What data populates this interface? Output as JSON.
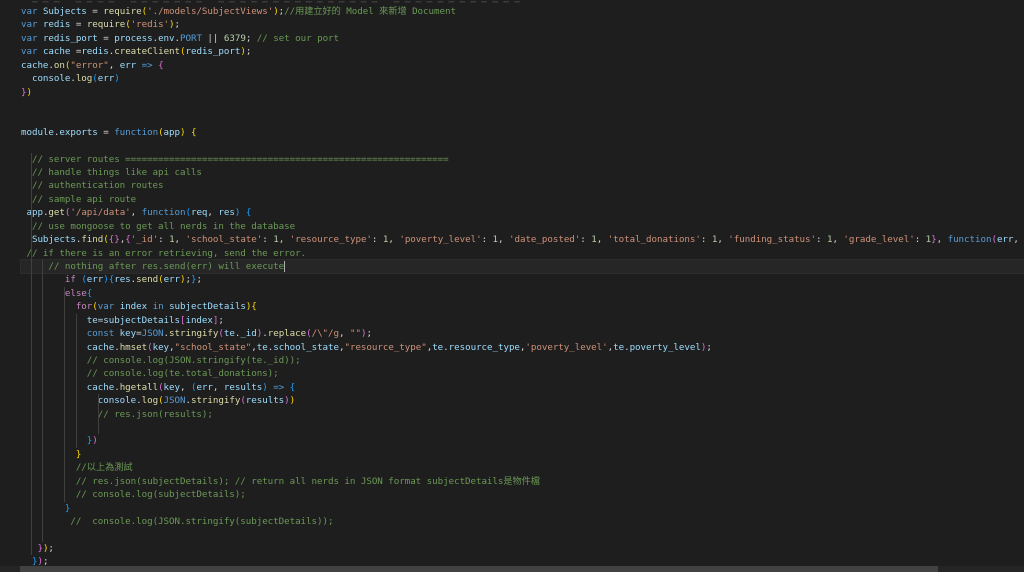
{
  "editor": {
    "top_partial": "  ─ ─ ─   ─ ─ ─ ─   ─ ─ ─ ─ ─ ─ ─   ─ ─ ─ ─ ─ ─ ─ ─ ─ ─ ─ ─ ─ ─ ─   ─ ─ ─ ─ ─ ─ ─ ─ ─ ─ ─ ─",
    "lines": [
      [
        [
          "kw",
          "var "
        ],
        [
          "var",
          "Subjects"
        ],
        [
          "pn",
          " = "
        ],
        [
          "fn",
          "require"
        ],
        [
          "br1",
          "("
        ],
        [
          "str",
          "'./models/SubjectViews'"
        ],
        [
          "br1",
          ")"
        ],
        [
          "pn",
          ";"
        ],
        [
          "cm",
          "//用建立好的 Model 來新增 Document"
        ]
      ],
      [
        [
          "kw",
          "var "
        ],
        [
          "var",
          "redis"
        ],
        [
          "pn",
          " = "
        ],
        [
          "fn",
          "require"
        ],
        [
          "br1",
          "("
        ],
        [
          "str",
          "'redis'"
        ],
        [
          "br1",
          ")"
        ],
        [
          "pn",
          ";"
        ]
      ],
      [
        [
          "kw",
          "var "
        ],
        [
          "var",
          "redis_port"
        ],
        [
          "pn",
          " = "
        ],
        [
          "var",
          "process"
        ],
        [
          "pn",
          "."
        ],
        [
          "var",
          "env"
        ],
        [
          "pn",
          "."
        ],
        [
          "kw",
          "PORT"
        ],
        [
          "pn",
          " || "
        ],
        [
          "num",
          "6379"
        ],
        [
          "pn",
          "; "
        ],
        [
          "cm",
          "// set our port"
        ]
      ],
      [
        [
          "kw",
          "var "
        ],
        [
          "var",
          "cache"
        ],
        [
          "pn",
          " ="
        ],
        [
          "var",
          "redis"
        ],
        [
          "pn",
          "."
        ],
        [
          "fn",
          "createClient"
        ],
        [
          "br1",
          "("
        ],
        [
          "var",
          "redis_port"
        ],
        [
          "br1",
          ")"
        ],
        [
          "pn",
          ";"
        ]
      ],
      [
        [
          "var",
          "cache"
        ],
        [
          "pn",
          "."
        ],
        [
          "fn",
          "on"
        ],
        [
          "br1",
          "("
        ],
        [
          "str",
          "\"error\""
        ],
        [
          "pn",
          ", "
        ],
        [
          "var",
          "err"
        ],
        [
          "pn",
          " "
        ],
        [
          "kw",
          "=>"
        ],
        [
          "pn",
          " "
        ],
        [
          "br2",
          "{"
        ]
      ],
      [
        [
          "pn",
          "  "
        ],
        [
          "var",
          "console"
        ],
        [
          "pn",
          "."
        ],
        [
          "fn",
          "log"
        ],
        [
          "br3",
          "("
        ],
        [
          "var",
          "err"
        ],
        [
          "br3",
          ")"
        ]
      ],
      [
        [
          "br2",
          "}"
        ],
        [
          "br1",
          ")"
        ]
      ],
      [],
      [],
      [
        [
          "var",
          "module"
        ],
        [
          "pn",
          "."
        ],
        [
          "var",
          "exports"
        ],
        [
          "pn",
          " = "
        ],
        [
          "kw",
          "function"
        ],
        [
          "br1",
          "("
        ],
        [
          "var",
          "app"
        ],
        [
          "br1",
          ")"
        ],
        [
          "pn",
          " "
        ],
        [
          "br1",
          "{"
        ]
      ],
      [],
      [
        [
          "pn",
          "  "
        ],
        [
          "cm",
          "// server routes ==========================================================="
        ]
      ],
      [
        [
          "pn",
          "  "
        ],
        [
          "cm",
          "// handle things like api calls"
        ]
      ],
      [
        [
          "pn",
          "  "
        ],
        [
          "cm",
          "// authentication routes"
        ]
      ],
      [
        [
          "pn",
          "  "
        ],
        [
          "cm",
          "// sample api route"
        ]
      ],
      [
        [
          "pn",
          " "
        ],
        [
          "var",
          "app"
        ],
        [
          "pn",
          "."
        ],
        [
          "fn",
          "get"
        ],
        [
          "br2",
          "("
        ],
        [
          "str",
          "'/api/data'"
        ],
        [
          "pn",
          ", "
        ],
        [
          "kw",
          "function"
        ],
        [
          "br3",
          "("
        ],
        [
          "var",
          "req"
        ],
        [
          "pn",
          ", "
        ],
        [
          "var",
          "res"
        ],
        [
          "br3",
          ")"
        ],
        [
          "pn",
          " "
        ],
        [
          "br3",
          "{"
        ]
      ],
      [
        [
          "pn",
          "  "
        ],
        [
          "cm",
          "// use mongoose to get all nerds in the database"
        ]
      ],
      [
        [
          "pn",
          "  "
        ],
        [
          "var",
          "Subjects"
        ],
        [
          "pn",
          "."
        ],
        [
          "fn",
          "find"
        ],
        [
          "br1",
          "("
        ],
        [
          "br2",
          "{}"
        ],
        [
          "pn",
          ","
        ],
        [
          "br2",
          "{"
        ],
        [
          "str",
          "'_id'"
        ],
        [
          "pn",
          ": "
        ],
        [
          "num",
          "1"
        ],
        [
          "pn",
          ", "
        ],
        [
          "str",
          "'school_state'"
        ],
        [
          "pn",
          ": "
        ],
        [
          "num",
          "1"
        ],
        [
          "pn",
          ", "
        ],
        [
          "str",
          "'resource_type'"
        ],
        [
          "pn",
          ": "
        ],
        [
          "num",
          "1"
        ],
        [
          "pn",
          ", "
        ],
        [
          "str",
          "'poverty_level'"
        ],
        [
          "pn",
          ": "
        ],
        [
          "num",
          "1"
        ],
        [
          "pn",
          ", "
        ],
        [
          "str",
          "'date_posted'"
        ],
        [
          "pn",
          ": "
        ],
        [
          "num",
          "1"
        ],
        [
          "pn",
          ", "
        ],
        [
          "str",
          "'total_donations'"
        ],
        [
          "pn",
          ": "
        ],
        [
          "num",
          "1"
        ],
        [
          "pn",
          ", "
        ],
        [
          "str",
          "'funding_status'"
        ],
        [
          "pn",
          ": "
        ],
        [
          "num",
          "1"
        ],
        [
          "pn",
          ", "
        ],
        [
          "str",
          "'grade_level'"
        ],
        [
          "pn",
          ": "
        ],
        [
          "num",
          "1"
        ],
        [
          "br2",
          "}"
        ],
        [
          "pn",
          ", "
        ],
        [
          "kw",
          "function"
        ],
        [
          "br2",
          "("
        ],
        [
          "var",
          "err"
        ],
        [
          "pn",
          ", s"
        ]
      ],
      [
        [
          "pn",
          " "
        ],
        [
          "cm",
          "// if there is an error retrieving, send the error."
        ]
      ],
      [
        [
          "pn",
          "     "
        ],
        [
          "cm",
          "// nothing after res.send(err) will execute"
        ],
        [
          "cursor",
          ""
        ]
      ],
      [
        [
          "pn",
          "        "
        ],
        [
          "ctl",
          "if"
        ],
        [
          "pn",
          " "
        ],
        [
          "br3",
          "("
        ],
        [
          "var",
          "err"
        ],
        [
          "br3",
          ")"
        ],
        [
          "br3",
          "{"
        ],
        [
          "var",
          "res"
        ],
        [
          "pn",
          "."
        ],
        [
          "fn",
          "send"
        ],
        [
          "br1",
          "("
        ],
        [
          "var",
          "err"
        ],
        [
          "br1",
          ")"
        ],
        [
          "pn",
          ";"
        ],
        [
          "br3",
          "}"
        ],
        [
          "pn",
          ";"
        ]
      ],
      [
        [
          "pn",
          "        "
        ],
        [
          "ctl",
          "else"
        ],
        [
          "br3",
          "{"
        ]
      ],
      [
        [
          "pn",
          "          "
        ],
        [
          "ctl",
          "for"
        ],
        [
          "br1",
          "("
        ],
        [
          "kw",
          "var "
        ],
        [
          "var",
          "index"
        ],
        [
          "pn",
          " "
        ],
        [
          "kw",
          "in"
        ],
        [
          "pn",
          " "
        ],
        [
          "var",
          "subjectDetails"
        ],
        [
          "br1",
          ")"
        ],
        [
          "br1",
          "{"
        ]
      ],
      [
        [
          "pn",
          "            "
        ],
        [
          "var",
          "te"
        ],
        [
          "pn",
          "="
        ],
        [
          "var",
          "subjectDetails"
        ],
        [
          "br2",
          "["
        ],
        [
          "var",
          "index"
        ],
        [
          "br2",
          "]"
        ],
        [
          "pn",
          ";"
        ]
      ],
      [
        [
          "pn",
          "            "
        ],
        [
          "kw",
          "const "
        ],
        [
          "var",
          "key"
        ],
        [
          "pn",
          "="
        ],
        [
          "kw",
          "JSON"
        ],
        [
          "pn",
          "."
        ],
        [
          "fn",
          "stringify"
        ],
        [
          "br2",
          "("
        ],
        [
          "var",
          "te"
        ],
        [
          "pn",
          "."
        ],
        [
          "var",
          "_id"
        ],
        [
          "br2",
          ")"
        ],
        [
          "pn",
          "."
        ],
        [
          "fn",
          "replace"
        ],
        [
          "br2",
          "("
        ],
        [
          "str",
          "/\\\"/g"
        ],
        [
          "pn",
          ", "
        ],
        [
          "str",
          "\"\""
        ],
        [
          "br2",
          ")"
        ],
        [
          "pn",
          ";"
        ]
      ],
      [
        [
          "pn",
          "            "
        ],
        [
          "var",
          "cache"
        ],
        [
          "pn",
          "."
        ],
        [
          "fn",
          "hmset"
        ],
        [
          "br2",
          "("
        ],
        [
          "var",
          "key"
        ],
        [
          "pn",
          ","
        ],
        [
          "str",
          "\"school_state\""
        ],
        [
          "pn",
          ","
        ],
        [
          "var",
          "te"
        ],
        [
          "pn",
          "."
        ],
        [
          "var",
          "school_state"
        ],
        [
          "pn",
          ","
        ],
        [
          "str",
          "\"resource_type\""
        ],
        [
          "pn",
          ","
        ],
        [
          "var",
          "te"
        ],
        [
          "pn",
          "."
        ],
        [
          "var",
          "resource_type"
        ],
        [
          "pn",
          ","
        ],
        [
          "str",
          "'poverty_level'"
        ],
        [
          "pn",
          ","
        ],
        [
          "var",
          "te"
        ],
        [
          "pn",
          "."
        ],
        [
          "var",
          "poverty_level"
        ],
        [
          "br2",
          ")"
        ],
        [
          "pn",
          ";"
        ]
      ],
      [
        [
          "pn",
          "            "
        ],
        [
          "cm",
          "// console.log(JSON.stringify(te._id));"
        ]
      ],
      [
        [
          "pn",
          "            "
        ],
        [
          "cm",
          "// console.log(te.total_donations);"
        ]
      ],
      [
        [
          "pn",
          "            "
        ],
        [
          "var",
          "cache"
        ],
        [
          "pn",
          "."
        ],
        [
          "fn",
          "hgetall"
        ],
        [
          "br2",
          "("
        ],
        [
          "var",
          "key"
        ],
        [
          "pn",
          ", "
        ],
        [
          "br3",
          "("
        ],
        [
          "var",
          "err"
        ],
        [
          "pn",
          ", "
        ],
        [
          "var",
          "results"
        ],
        [
          "br3",
          ")"
        ],
        [
          "pn",
          " "
        ],
        [
          "kw",
          "=>"
        ],
        [
          "pn",
          " "
        ],
        [
          "br3",
          "{"
        ]
      ],
      [
        [
          "pn",
          "              "
        ],
        [
          "var",
          "console"
        ],
        [
          "pn",
          "."
        ],
        [
          "fn",
          "log"
        ],
        [
          "br1",
          "("
        ],
        [
          "kw",
          "JSON"
        ],
        [
          "pn",
          "."
        ],
        [
          "fn",
          "stringify"
        ],
        [
          "br2",
          "("
        ],
        [
          "var",
          "results"
        ],
        [
          "br2",
          ")"
        ],
        [
          "br1",
          ")"
        ]
      ],
      [
        [
          "pn",
          "              "
        ],
        [
          "cm",
          "// res.json(results);"
        ]
      ],
      [],
      [
        [
          "pn",
          "            "
        ],
        [
          "br3",
          "}"
        ],
        [
          "br2",
          ")"
        ]
      ],
      [
        [
          "pn",
          "          "
        ],
        [
          "br1",
          "}"
        ]
      ],
      [
        [
          "pn",
          "          "
        ],
        [
          "cm",
          "//以上為測試"
        ]
      ],
      [
        [
          "pn",
          "          "
        ],
        [
          "cm",
          "// res.json(subjectDetails); // return all nerds in JSON format subjectDetails是物件檔"
        ]
      ],
      [
        [
          "pn",
          "          "
        ],
        [
          "cm",
          "// console.log(subjectDetails);"
        ]
      ],
      [
        [
          "pn",
          "        "
        ],
        [
          "br3",
          "}"
        ]
      ],
      [
        [
          "pn",
          "         "
        ],
        [
          "cm",
          "//  console.log(JSON.stringify(subjectDetails));"
        ]
      ],
      [],
      [
        [
          "pn",
          "   "
        ],
        [
          "br2",
          "}"
        ],
        [
          "br1",
          ")"
        ],
        [
          "pn",
          ";"
        ]
      ],
      [
        [
          "pn",
          "  "
        ],
        [
          "br3",
          "}"
        ],
        [
          "br2",
          ")"
        ],
        [
          "pn",
          ";"
        ]
      ]
    ]
  }
}
